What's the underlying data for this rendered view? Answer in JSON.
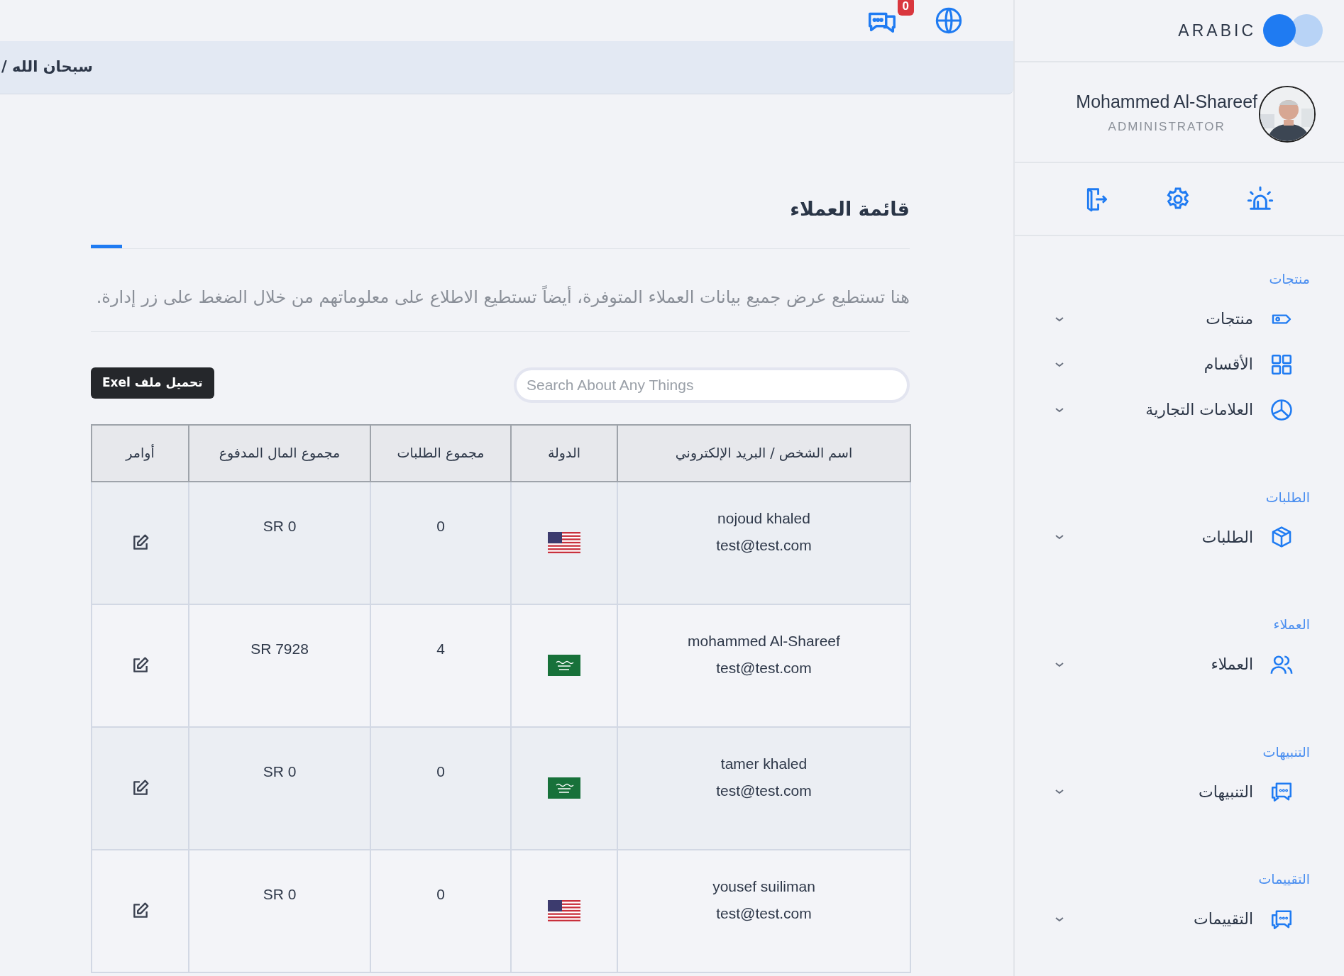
{
  "topbar": {
    "messages_badge": "0"
  },
  "breadcrumb": "سبحان الله /",
  "page": {
    "title": "قائمة العملاء",
    "description": "هنا تستطيع عرض جميع بيانات العملاء المتوفرة، أيضاً تستطيع الاطلاع على معلوماتهم من خلال الضغط على زر إدارة.",
    "export_button": "تحميل ملف Exel",
    "search": {
      "placeholder": "Search About Any Things"
    }
  },
  "table": {
    "columns": [
      "اسم الشخص / البريد الإلكتروني",
      "الدولة",
      "مجموع الطلبات",
      "مجموع المال المدفوع",
      "أوامر"
    ],
    "rows": [
      {
        "name": "nojoud khaled",
        "email": "test@test.com",
        "kind": "us",
        "orders": "0",
        "paid": "SR 0"
      },
      {
        "name": "mohammed Al-Shareef",
        "email": "test@test.com",
        "kind": "sa",
        "orders": "4",
        "paid": "SR 7928"
      },
      {
        "name": "tamer khaled",
        "email": "test@test.com",
        "kind": "sa",
        "orders": "0",
        "paid": "SR 0"
      },
      {
        "name": "yousef suiliman",
        "email": "test@test.com",
        "kind": "us",
        "orders": "0",
        "paid": "SR 0"
      }
    ]
  },
  "sidebar": {
    "language_toggle": {
      "label": "ARABIC",
      "on": true
    },
    "user": {
      "name": "Mohammed Al-Shareef",
      "role": "ADMINISTRATOR"
    },
    "sections": [
      {
        "heading": "منتجات",
        "items": [
          {
            "label": "منتجات",
            "kind": "tag"
          },
          {
            "label": "الأقسام",
            "kind": "grid"
          },
          {
            "label": "العلامات التجارية",
            "kind": "pie"
          }
        ]
      },
      {
        "heading": "الطلبات",
        "items": [
          {
            "label": "الطلبات",
            "kind": "box"
          }
        ]
      },
      {
        "heading": "العملاء",
        "items": [
          {
            "label": "العملاء",
            "kind": "users"
          }
        ]
      },
      {
        "heading": "التنبيهات",
        "items": [
          {
            "label": "التنبيهات",
            "kind": "chat"
          }
        ]
      },
      {
        "heading": "التقييمات",
        "items": [
          {
            "label": "التقييمات",
            "kind": "chat"
          }
        ]
      }
    ]
  }
}
